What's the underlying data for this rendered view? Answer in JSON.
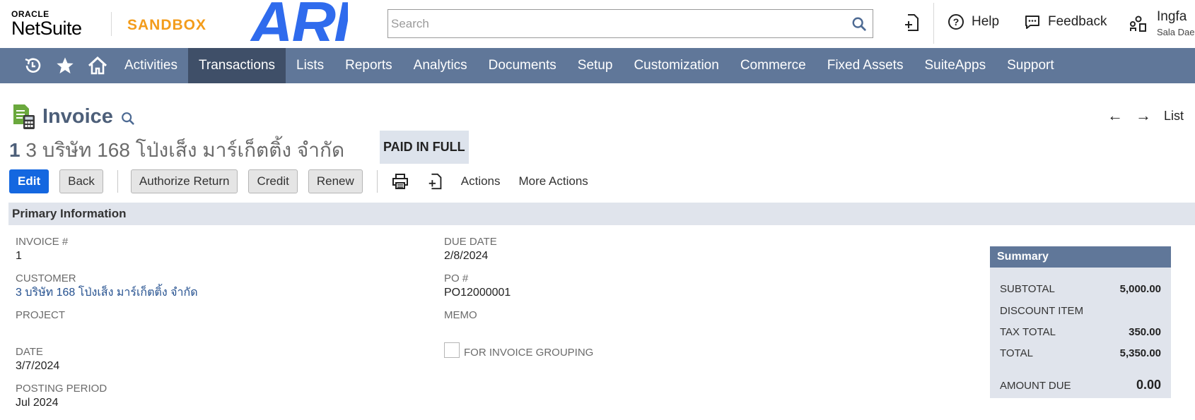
{
  "header": {
    "brand_oracle": "ORACLE",
    "brand_netsuite": "NetSuite",
    "environment": "SANDBOX",
    "customer_logo": "ARI",
    "search_placeholder": "Search",
    "help_label": "Help",
    "feedback_label": "Feedback",
    "user_name": "Ingfa",
    "user_sub": "Sala Dae"
  },
  "nav": {
    "items": [
      {
        "label": "Activities"
      },
      {
        "label": "Transactions",
        "active": true
      },
      {
        "label": "Lists"
      },
      {
        "label": "Reports"
      },
      {
        "label": "Analytics"
      },
      {
        "label": "Documents"
      },
      {
        "label": "Setup"
      },
      {
        "label": "Customization"
      },
      {
        "label": "Commerce"
      },
      {
        "label": "Fixed Assets"
      },
      {
        "label": "SuiteApps"
      },
      {
        "label": "Support"
      }
    ]
  },
  "record": {
    "type_title": "Invoice",
    "number": "1",
    "customer_name": "3 บริษัท 168 โป่งเส็ง มาร์เก็ตติ้ง จำกัด",
    "status": "PAID IN FULL",
    "list_label": "List"
  },
  "toolbar": {
    "edit_label": "Edit",
    "back_label": "Back",
    "authorize_return_label": "Authorize Return",
    "credit_label": "Credit",
    "renew_label": "Renew",
    "actions_label": "Actions",
    "more_actions_label": "More Actions"
  },
  "primary": {
    "section_title": "Primary Information",
    "invoice_no_label": "INVOICE #",
    "invoice_no_value": "1",
    "customer_label": "CUSTOMER",
    "customer_value": "3 บริษัท 168 โป่งเส็ง มาร์เก็ตติ้ง จำกัด",
    "project_label": "PROJECT",
    "date_label": "DATE",
    "date_value": "3/7/2024",
    "posting_period_label": "POSTING PERIOD",
    "posting_period_value": "Jul 2024",
    "due_date_label": "DUE DATE",
    "due_date_value": "2/8/2024",
    "po_label": "PO #",
    "po_value": "PO12000001",
    "memo_label": "MEMO",
    "invoice_grouping_label": "FOR INVOICE GROUPING"
  },
  "summary": {
    "title": "Summary",
    "subtotal_label": "SUBTOTAL",
    "subtotal_value": "5,000.00",
    "discount_label": "DISCOUNT ITEM",
    "tax_total_label": "TAX TOTAL",
    "tax_total_value": "350.00",
    "total_label": "TOTAL",
    "total_value": "5,350.00",
    "amount_due_label": "AMOUNT DUE",
    "amount_due_value": "0.00"
  },
  "colors": {
    "nav_bg": "#607799",
    "nav_active": "#3f4f68",
    "primary_button": "#1467e0",
    "sandbox_orange": "#f39c1b",
    "ari_blue": "#2f6bed",
    "section_bg": "#e0e4ec",
    "link": "#24508f"
  },
  "icons": {
    "recent": "recent-history-icon",
    "favorites": "star-icon",
    "home": "home-icon",
    "search": "search-icon",
    "new_record": "new-record-icon",
    "help": "help-circle-icon",
    "feedback": "chat-bubble-icon",
    "roles": "user-roles-icon",
    "print": "print-icon",
    "invoice_type": "invoice-document-icon"
  }
}
